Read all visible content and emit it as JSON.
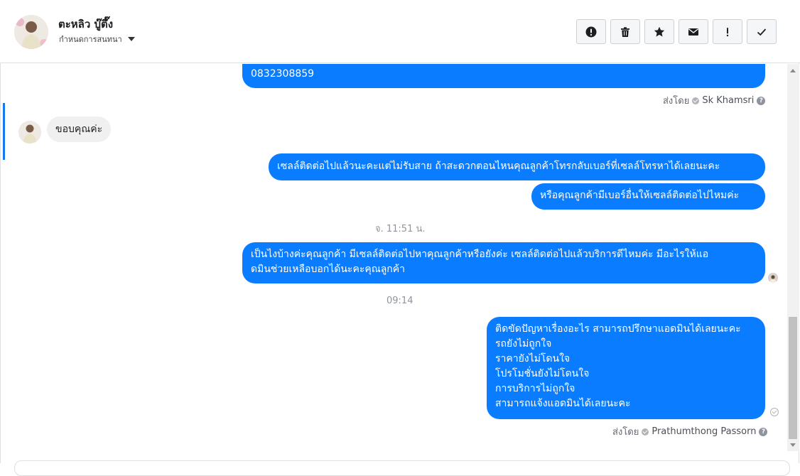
{
  "header": {
    "contact_name": "ตะหลิว บู๊ตึ๊ง",
    "subtitle": "กำหนดการสนทนา",
    "toolbar_icons": [
      "exclamation-circle-icon",
      "trash-icon",
      "star-icon",
      "envelope-icon",
      "exclamation-icon",
      "checkmark-icon"
    ]
  },
  "messages": {
    "m0_text": "0832308859",
    "m0_sent_by_label": "ส่งโดย",
    "m0_sender": "Sk Khamsri",
    "incoming_text": "ขอบคุณค่ะ",
    "m1_text": "เซลล์ติดต่อไปแล้วนะคะแต่ไม่รับสาย ถ้าสะดวกตอนไหนคุณลูกค้าโทรกลับเบอร์ที่เซลล์โทรหาได้เลยนะคะ",
    "m2_text": "หรือคุณลูกค้ามีเบอร์อื่นให้เซลล์ติดต่อไปไหมค่ะ",
    "time1": "จ. 11:51 น.",
    "m3_line1": "เป็นไงบ้างค่ะคุณลูกค้า มีเซลล์ติดต่อไปหาคุณลูกค้าหรือยังค่ะ  เซลล์ติดต่อไปแล้วบริการดีไหมค่ะ มีอะไรให้แอ",
    "m3_line2": "ดมินช่วยเหลือบอกได้นะคะคุณลูกค้า",
    "time2": "09:14",
    "m4_lines": [
      "ติดขัดปัญหาเรื่องอะไร สามารถปรึกษาแอดมินได้เลยนะคะ",
      "รถยังไม่ถูกใจ",
      "ราคายังไม่โดนใจ",
      "โปรโมชั่นยังไม่โดนใจ",
      "การบริการไม่ถูกใจ",
      "สามารถแจ้งแอดมินได้เลยนะคะ"
    ],
    "m4_sent_by_label": "ส่งโดย",
    "m4_sender": "Prathumthong Passorn"
  },
  "colors": {
    "outgoing_bubble": "#0a7cff",
    "incoming_bubble": "#f0f0f0",
    "accent": "#1877f2"
  }
}
